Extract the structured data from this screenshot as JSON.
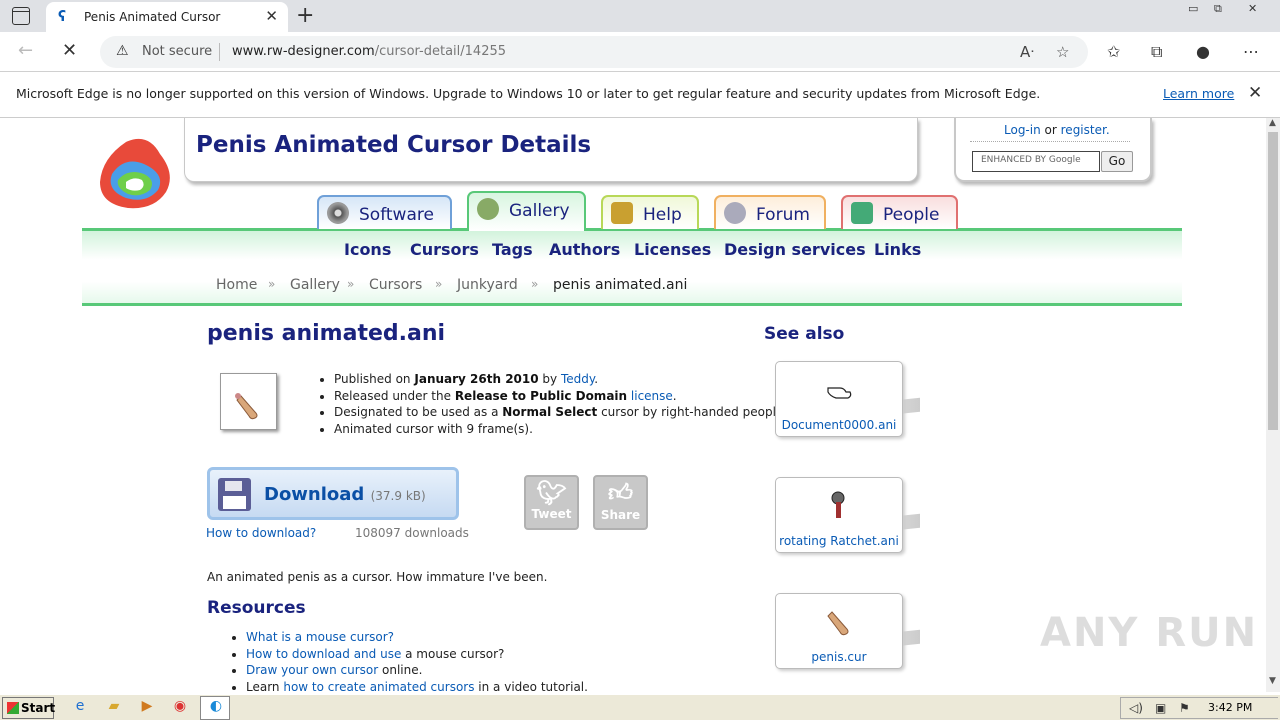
{
  "browser": {
    "tab_title": "Penis Animated Cursor",
    "not_secure": "Not secure",
    "url_host": "www.rw-designer.com",
    "url_path": "/cursor-detail/14255",
    "notice_text": "Microsoft Edge is no longer supported on this version of Windows. Upgrade to Windows 10 or later to get regular feature and security updates from Microsoft Edge.",
    "notice_link": "Learn more"
  },
  "site": {
    "title": "Penis Animated Cursor Details",
    "login": "Log-in",
    "or": "or",
    "register": "register.",
    "search_placeholder": "ENHANCED BY Google",
    "search_go": "Go",
    "tabs": [
      {
        "label": "Software",
        "color": "#6fa0d8",
        "bg": "#d6e6f7"
      },
      {
        "label": "Gallery",
        "color": "#58c878",
        "bg": "#d8f5e0"
      },
      {
        "label": "Help",
        "color": "#b8d858",
        "bg": "#f0f8d8"
      },
      {
        "label": "Forum",
        "color": "#f0b060",
        "bg": "#fdeedb"
      },
      {
        "label": "People",
        "color": "#e07070",
        "bg": "#f9dede"
      }
    ],
    "subnav": [
      "Icons",
      "Cursors",
      "Tags",
      "Authors",
      "Licenses",
      "Design services",
      "Links"
    ],
    "breadcrumb": [
      "Home",
      "Gallery",
      "Cursors",
      "Junkyard",
      "penis animated.ani"
    ]
  },
  "content": {
    "heading": "penis animated.ani",
    "published_prefix": "Published on",
    "published_date": "January 26th 2010",
    "by": "by",
    "author": "Teddy",
    "released_prefix": "Released under the",
    "license_name": "Release to Public Domain",
    "license_link": "license",
    "designated_prefix": "Designated to be used as a",
    "cursor_role": "Normal Select",
    "designated_suffix": "cursor by right-handed people.",
    "frames": "Animated cursor with 9 frame(s).",
    "download_label": "Download",
    "download_size": "(37.9 kB)",
    "how_to_download": "How to download?",
    "download_count": "108097 downloads",
    "tweet": "Tweet",
    "share": "Share",
    "description": "An animated penis as a cursor. How immature I've been.",
    "resources_heading": "Resources",
    "resources": [
      {
        "link": "What is a mouse cursor?",
        "rest": ""
      },
      {
        "link": "How to download and use",
        "rest": " a mouse cursor?"
      },
      {
        "link": "Draw your own cursor",
        "rest": " online."
      },
      {
        "pre": "Learn ",
        "link": "how to create animated cursors",
        "rest": " in a video tutorial."
      }
    ],
    "see_also_heading": "See also",
    "see_also": [
      "Document0000.ani",
      "rotating Ratchet.ani",
      "penis.cur"
    ]
  },
  "taskbar": {
    "start": "Start",
    "clock": "3:42 PM"
  },
  "watermark": "ANY RUN"
}
